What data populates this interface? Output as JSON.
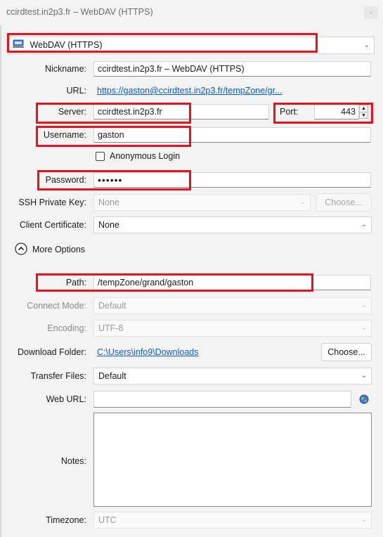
{
  "window": {
    "title": "ccirdtest.in2p3.fr – WebDAV (HTTPS)",
    "close_glyph": "×"
  },
  "protocol": {
    "value": "WebDAV (HTTPS)"
  },
  "nickname": {
    "label": "Nickname:",
    "value": "ccirdtest.in2p3.fr – WebDAV (HTTPS)"
  },
  "url": {
    "label": "URL:",
    "value": "https://gaston@ccirdtest.in2p3.fr/tempZone/gr..."
  },
  "server": {
    "label": "Server:",
    "value": "ccirdtest.in2p3.fr"
  },
  "port": {
    "label": "Port:",
    "value": "443"
  },
  "username": {
    "label": "Username:",
    "value": "gaston"
  },
  "anonymous": {
    "label": "Anonymous Login",
    "checked": false
  },
  "password": {
    "label": "Password:",
    "value": "••••••"
  },
  "ssh_key": {
    "label": "SSH Private Key:",
    "value": "None",
    "choose": "Choose..."
  },
  "client_cert": {
    "label": "Client Certificate:",
    "value": "None"
  },
  "more_options": {
    "label": "More Options"
  },
  "path": {
    "label": "Path:",
    "value": "/tempZone/grand/gaston"
  },
  "connect_mode": {
    "label": "Connect Mode:",
    "value": "Default"
  },
  "encoding": {
    "label": "Encoding:",
    "value": "UTF-8"
  },
  "download_folder": {
    "label": "Download Folder:",
    "value": "C:\\Users\\info9\\Downloads",
    "choose": "Choose..."
  },
  "transfer_files": {
    "label": "Transfer Files:",
    "value": "Default"
  },
  "web_url": {
    "label": "Web URL:",
    "value": ""
  },
  "notes": {
    "label": "Notes:",
    "value": ""
  },
  "timezone": {
    "label": "Timezone:",
    "value": "UTC"
  },
  "colors": {
    "highlight": "#e8121c",
    "link": "#0a5bd0",
    "background": "#f3f3f3"
  }
}
